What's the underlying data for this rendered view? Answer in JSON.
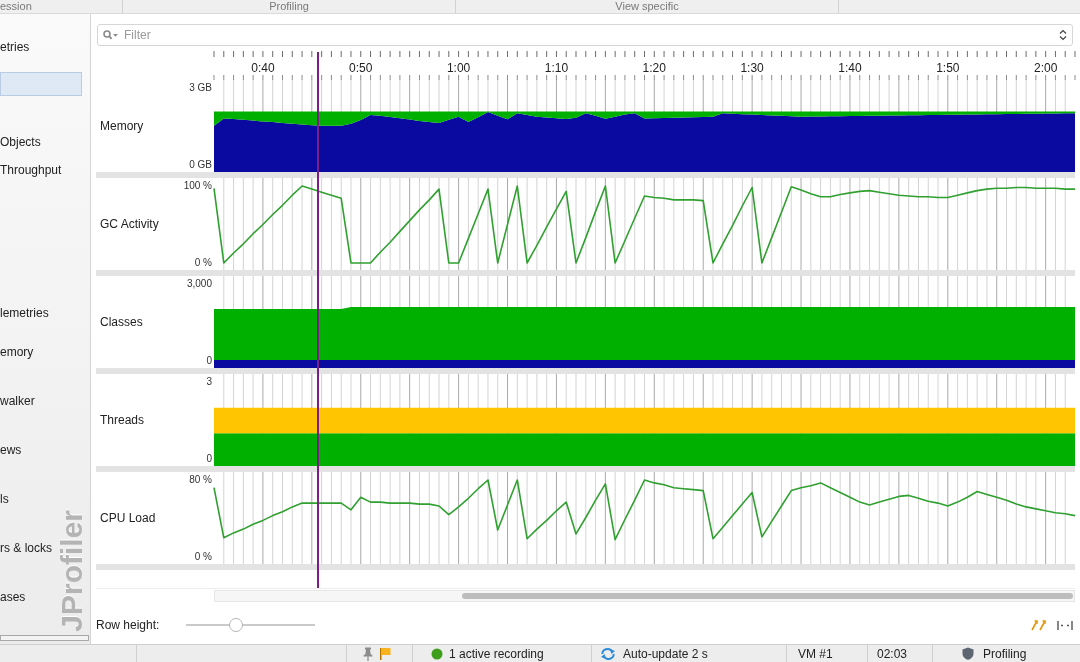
{
  "section_headers": [
    "ession",
    "Profiling",
    "View specific"
  ],
  "sidebar": {
    "groups": [
      {
        "items": [
          {
            "label": "etries",
            "selected": false
          },
          {
            "selected": true
          },
          {
            "label": "Objects",
            "selected": false
          },
          {
            "label": "Throughput",
            "selected": false
          }
        ]
      },
      {
        "items": [
          {
            "label": "lemetries",
            "selected": false
          },
          {
            "label": "emory",
            "selected": false
          },
          {
            "label": "walker",
            "selected": false
          },
          {
            "label": "ews",
            "selected": false
          },
          {
            "label": "ls",
            "selected": false
          },
          {
            "label": "rs & locks",
            "selected": false
          },
          {
            "label": "ases",
            "selected": false
          }
        ]
      }
    ],
    "logo": "JProfiler"
  },
  "filter": {
    "placeholder": "Filter"
  },
  "rows": [
    {
      "label": "Memory",
      "chart_data": {
        "type": "area",
        "stacked": true,
        "grid": true,
        "categories": [
          null,
          null,
          null,
          null,
          null,
          "0:40",
          null,
          null,
          null,
          null,
          null,
          null,
          null,
          null,
          null,
          "0:50",
          null,
          null,
          null,
          null,
          null,
          null,
          null,
          null,
          null,
          "1:00",
          null,
          null,
          null,
          null,
          null,
          null,
          null,
          null,
          null,
          "1:10",
          null,
          null,
          null,
          null,
          null,
          null,
          null,
          null,
          null,
          "1:20",
          null,
          null,
          null,
          null,
          null,
          null,
          null,
          null,
          null,
          "1:30",
          null,
          null,
          null,
          null,
          null,
          null,
          null,
          null,
          null,
          "1:40",
          null,
          null,
          null,
          null,
          null,
          null,
          null,
          null,
          null,
          "1:50",
          null,
          null,
          null,
          null,
          null,
          null,
          null,
          null,
          null,
          "2:00",
          null,
          null,
          null
        ],
        "ylim": [
          0,
          3
        ],
        "yticks": [
          {
            "value": 0,
            "label": "0 GB"
          },
          {
            "value": 3,
            "label": "3 GB"
          }
        ],
        "series": [
          {
            "color": "#0a0aa0",
            "values": [
              1.53,
              1.81,
              1.79,
              1.76,
              1.73,
              1.7,
              1.67,
              1.64,
              1.61,
              1.58,
              1.55,
              1.53,
              1.53,
              1.53,
              1.61,
              1.75,
              1.95,
              1.92,
              1.87,
              1.82,
              1.77,
              1.72,
              1.67,
              1.64,
              1.76,
              1.88,
              1.67,
              1.86,
              2.06,
              1.92,
              1.78,
              2.02,
              1.95,
              1.88,
              1.85,
              1.82,
              1.79,
              1.84,
              2.02,
              1.92,
              1.8,
              1.88,
              1.97,
              2.02,
              1.81,
              1.82,
              1.83,
              1.84,
              1.85,
              1.86,
              1.87,
              1.88,
              2.02,
              2.0,
              1.98,
              1.97,
              1.95,
              1.93,
              1.92,
              1.9,
              1.88,
              1.89,
              1.89,
              1.9,
              1.9,
              1.91,
              1.91,
              1.92,
              1.92,
              1.93,
              1.93,
              1.94,
              1.94,
              1.95,
              1.95,
              1.96,
              1.96,
              1.97,
              1.97,
              1.98,
              1.98,
              1.99,
              1.99,
              2.0,
              2.0,
              2.01,
              2.01,
              2.02,
              2.02
            ]
          },
          {
            "color": "#00b000",
            "values": [
              0.56,
              0.28,
              0.3,
              0.33,
              0.36,
              0.39,
              0.42,
              0.45,
              0.48,
              0.51,
              0.54,
              0.56,
              0.56,
              0.56,
              0.48,
              0.34,
              0.14,
              0.17,
              0.22,
              0.27,
              0.32,
              0.37,
              0.42,
              0.45,
              0.33,
              0.21,
              0.42,
              0.23,
              0.03,
              0.17,
              0.31,
              0.07,
              0.14,
              0.21,
              0.24,
              0.27,
              0.3,
              0.25,
              0.07,
              0.17,
              0.29,
              0.21,
              0.12,
              0.07,
              0.28,
              0.27,
              0.26,
              0.25,
              0.24,
              0.23,
              0.22,
              0.21,
              0.07,
              0.09,
              0.11,
              0.12,
              0.14,
              0.16,
              0.17,
              0.19,
              0.21,
              0.2,
              0.2,
              0.19,
              0.19,
              0.18,
              0.18,
              0.17,
              0.17,
              0.16,
              0.16,
              0.15,
              0.15,
              0.14,
              0.14,
              0.13,
              0.13,
              0.12,
              0.12,
              0.11,
              0.11,
              0.1,
              0.1,
              0.09,
              0.09,
              0.08,
              0.08,
              0.07,
              0.07
            ]
          }
        ]
      }
    },
    {
      "label": "GC Activity",
      "chart_data": {
        "type": "line",
        "grid": true,
        "categories": [
          null,
          null,
          null,
          null,
          null,
          null,
          null,
          null,
          null,
          null,
          null,
          null,
          null,
          null,
          null,
          null,
          null,
          null,
          null,
          null,
          null,
          null,
          null,
          null,
          null,
          null,
          null,
          null,
          null,
          null,
          null,
          null,
          null,
          null,
          null,
          null,
          null,
          null,
          null,
          null,
          null,
          null,
          null,
          null,
          null,
          null,
          null,
          null,
          null,
          null,
          null,
          null,
          null,
          null,
          null,
          null,
          null,
          null,
          null,
          null,
          null,
          null,
          null,
          null,
          null,
          null,
          null,
          null,
          null,
          null,
          null,
          null,
          null,
          null,
          null,
          null,
          null,
          null,
          null,
          null,
          null,
          null,
          null,
          null,
          null,
          null,
          null,
          null,
          null
        ],
        "ylim": [
          0,
          100
        ],
        "yticks": [
          {
            "value": 0,
            "label": "0 %"
          },
          {
            "value": 100,
            "label": "100 %"
          }
        ],
        "series": [
          {
            "color": "#30a030",
            "values": [
              97,
              0,
              13,
              25,
              38,
              50,
              63,
              75,
              88,
              100,
              96,
              92,
              88,
              84,
              0,
              0,
              0,
              14,
              27,
              41,
              55,
              69,
              82,
              96,
              0,
              0,
              32,
              64,
              96,
              0,
              50,
              100,
              0,
              23,
              47,
              70,
              93,
              0,
              33,
              67,
              100,
              0,
              29,
              58,
              87,
              85,
              84,
              82,
              82,
              82,
              81,
              0,
              25,
              49,
              74,
              98,
              0,
              33,
              66,
              99,
              95,
              90,
              86,
              86,
              89,
              91,
              93,
              94,
              92,
              90,
              88,
              87,
              86,
              86,
              85,
              85,
              88,
              91,
              94,
              96,
              97,
              97,
              98,
              98,
              97,
              97,
              97,
              96,
              96
            ]
          }
        ]
      }
    },
    {
      "label": "Classes",
      "chart_data": {
        "type": "area",
        "stacked": true,
        "grid": true,
        "categories": [
          null,
          null,
          null,
          null,
          null,
          null,
          null,
          null,
          null,
          null,
          null,
          null,
          null,
          null,
          null,
          null,
          null,
          null,
          null,
          null,
          null,
          null,
          null,
          null,
          null,
          null,
          null,
          null,
          null,
          null,
          null,
          null,
          null,
          null,
          null,
          null,
          null,
          null,
          null,
          null,
          null,
          null,
          null,
          null,
          null,
          null,
          null,
          null,
          null,
          null,
          null,
          null,
          null,
          null,
          null,
          null,
          null,
          null,
          null,
          null,
          null,
          null,
          null,
          null,
          null,
          null,
          null,
          null,
          null,
          null,
          null,
          null,
          null,
          null,
          null,
          null,
          null,
          null,
          null,
          null,
          null,
          null,
          null,
          null,
          null,
          null,
          null,
          null,
          null
        ],
        "ylim": [
          0,
          3000
        ],
        "yticks": [
          {
            "value": 0,
            "label": "0"
          },
          {
            "value": 3000,
            "label": "3,000"
          }
        ],
        "series": [
          {
            "color": "#0a0aa0",
            "values": [
              40,
              40,
              40,
              40,
              40,
              40,
              40,
              40,
              40,
              40,
              40,
              40,
              40,
              40,
              40,
              40,
              40,
              40,
              40,
              40,
              40,
              40,
              40,
              40,
              40,
              40,
              40,
              40,
              40,
              40,
              40,
              40,
              40,
              40,
              40,
              40,
              40,
              40,
              40,
              40,
              40,
              40,
              40,
              40,
              40,
              40,
              40,
              40,
              40,
              40,
              40,
              40,
              40,
              40,
              40,
              40,
              40,
              40,
              40,
              40,
              40,
              40,
              40,
              40,
              40,
              40,
              40,
              40,
              40,
              40,
              40,
              40,
              40,
              40,
              40,
              40,
              40,
              40,
              40,
              40,
              40,
              40,
              40,
              40,
              40,
              40,
              40,
              40,
              40
            ]
          },
          {
            "color": "#00b000",
            "values": [
              1990,
              1990,
              1990,
              1990,
              1990,
              1990,
              1990,
              1990,
              1990,
              1990,
              1990,
              1990,
              1990,
              1990,
              2060,
              2060,
              2060,
              2060,
              2060,
              2060,
              2060,
              2060,
              2060,
              2060,
              2060,
              2060,
              2060,
              2060,
              2060,
              2060,
              2060,
              2060,
              2060,
              2060,
              2060,
              2060,
              2060,
              2060,
              2060,
              2060,
              2060,
              2060,
              2060,
              2060,
              2060,
              2060,
              2060,
              2060,
              2060,
              2060,
              2060,
              2060,
              2060,
              2060,
              2060,
              2060,
              2060,
              2060,
              2060,
              2060,
              2060,
              2060,
              2060,
              2060,
              2060,
              2060,
              2060,
              2060,
              2060,
              2060,
              2060,
              2060,
              2060,
              2060,
              2060,
              2060,
              2060,
              2060,
              2060,
              2060,
              2060,
              2060,
              2060,
              2060,
              2060,
              2060,
              2060,
              2060,
              2060
            ]
          }
        ]
      }
    },
    {
      "label": "Threads",
      "chart_data": {
        "type": "area",
        "stacked": true,
        "grid": true,
        "categories": [
          null,
          null,
          null,
          null,
          null,
          null,
          null,
          null,
          null,
          null,
          null,
          null,
          null,
          null,
          null,
          null,
          null,
          null,
          null,
          null,
          null,
          null,
          null,
          null,
          null,
          null,
          null,
          null,
          null,
          null,
          null,
          null,
          null,
          null,
          null,
          null,
          null,
          null,
          null,
          null,
          null,
          null,
          null,
          null,
          null,
          null,
          null,
          null,
          null,
          null,
          null,
          null,
          null,
          null,
          null,
          null,
          null,
          null,
          null,
          null,
          null,
          null,
          null,
          null,
          null,
          null,
          null,
          null,
          null,
          null,
          null,
          null,
          null,
          null,
          null,
          null,
          null,
          null,
          null,
          null,
          null,
          null,
          null,
          null,
          null,
          null,
          null,
          null,
          null
        ],
        "ylim": [
          0,
          3
        ],
        "yticks": [
          {
            "value": 0,
            "label": "0"
          },
          {
            "value": 3,
            "label": "3"
          }
        ],
        "series": [
          {
            "color": "#00b000",
            "values": [
              1,
              1,
              1,
              1,
              1,
              1,
              1,
              1,
              1,
              1,
              1,
              1,
              1,
              1,
              1,
              1,
              1,
              1,
              1,
              1,
              1,
              1,
              1,
              1,
              1,
              1,
              1,
              1,
              1,
              1,
              1,
              1,
              1,
              1,
              1,
              1,
              1,
              1,
              1,
              1,
              1,
              1,
              1,
              1,
              1,
              1,
              1,
              1,
              1,
              1,
              1,
              1,
              1,
              1,
              1,
              1,
              1,
              1,
              1,
              1,
              1,
              1,
              1,
              1,
              1,
              1,
              1,
              1,
              1,
              1,
              1,
              1,
              1,
              1,
              1,
              1,
              1,
              1,
              1,
              1,
              1,
              1,
              1,
              1,
              1,
              1,
              1,
              1,
              1
            ]
          },
          {
            "color": "#ffc600",
            "values": [
              1,
              1,
              1,
              1,
              1,
              1,
              1,
              1,
              1,
              1,
              1,
              1,
              1,
              1,
              1,
              1,
              1,
              1,
              1,
              1,
              1,
              1,
              1,
              1,
              1,
              1,
              1,
              1,
              1,
              1,
              1,
              1,
              1,
              1,
              1,
              1,
              1,
              1,
              1,
              1,
              1,
              1,
              1,
              1,
              1,
              1,
              1,
              1,
              1,
              1,
              1,
              1,
              1,
              1,
              1,
              1,
              1,
              1,
              1,
              1,
              1,
              1,
              1,
              1,
              1,
              1,
              1,
              1,
              1,
              1,
              1,
              1,
              1,
              1,
              1,
              1,
              1,
              1,
              1,
              1,
              1,
              1,
              1,
              1,
              1,
              1,
              1,
              1,
              1
            ]
          }
        ]
      }
    },
    {
      "label": "CPU Load",
      "chart_data": {
        "type": "line",
        "grid": true,
        "categories": [
          null,
          null,
          null,
          null,
          null,
          null,
          null,
          null,
          null,
          null,
          null,
          null,
          null,
          null,
          null,
          null,
          null,
          null,
          null,
          null,
          null,
          null,
          null,
          null,
          null,
          null,
          null,
          null,
          null,
          null,
          null,
          null,
          null,
          null,
          null,
          null,
          null,
          null,
          null,
          null,
          null,
          null,
          null,
          null,
          null,
          null,
          null,
          null,
          null,
          null,
          null,
          null,
          null,
          null,
          null,
          null,
          null,
          null,
          null,
          null,
          null,
          null,
          null,
          null,
          null,
          null,
          null,
          null,
          null,
          null,
          null,
          null,
          null,
          null,
          null,
          null,
          null,
          null,
          null,
          null,
          null,
          null,
          null,
          null,
          null,
          null,
          null,
          null,
          null
        ],
        "ylim": [
          0,
          80
        ],
        "yticks": [
          {
            "value": 0,
            "label": "0 %"
          },
          {
            "value": 80,
            "label": "80 %"
          }
        ],
        "series": [
          {
            "color": "#30a030",
            "values": [
              72,
              20,
              25,
              29,
              34,
              38,
              43,
              47,
              52,
              56,
              56,
              56,
              56,
              56,
              49,
              62,
              57,
              57,
              56,
              56,
              56,
              55,
              55,
              53,
              44,
              52,
              61,
              71,
              80,
              28,
              54,
              80,
              19,
              29,
              38,
              48,
              57,
              24,
              41,
              59,
              76,
              18,
              39,
              59,
              80,
              77,
              75,
              72,
              71,
              70,
              69,
              19,
              31,
              43,
              55,
              67,
              21,
              37,
              53,
              69,
              72,
              74,
              77,
              72,
              67,
              62,
              57,
              54,
              57,
              60,
              63,
              64,
              61,
              58,
              56,
              53,
              57,
              62,
              68,
              65,
              62,
              59,
              55,
              52,
              50,
              48,
              46,
              45,
              43
            ]
          }
        ]
      }
    }
  ],
  "row_height": {
    "label": "Row height:",
    "level": 0.39
  },
  "status_bar": {
    "recording": "1 active recording",
    "auto_update": "Auto-update 2 s",
    "vm": "VM #1",
    "elapsed": "02:03",
    "mode": "Profiling"
  }
}
